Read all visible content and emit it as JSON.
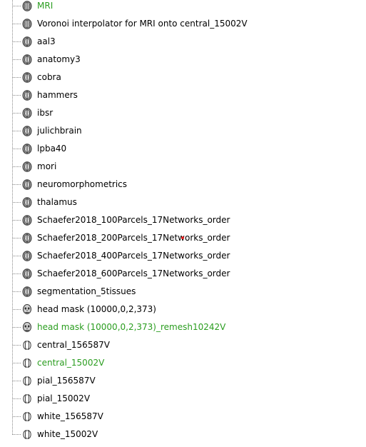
{
  "items": [
    {
      "label": "MRI",
      "icon": "volume-icon",
      "color": "#2a9d1f",
      "highlighted": true
    },
    {
      "label": "Voronoi interpolator for MRI onto central_15002V",
      "icon": "volume-icon",
      "highlighted": false
    },
    {
      "label": "aal3",
      "icon": "atlas-icon",
      "highlighted": false
    },
    {
      "label": "anatomy3",
      "icon": "atlas-icon",
      "highlighted": false
    },
    {
      "label": "cobra",
      "icon": "atlas-icon",
      "highlighted": false
    },
    {
      "label": "hammers",
      "icon": "atlas-icon",
      "highlighted": false
    },
    {
      "label": "ibsr",
      "icon": "atlas-icon",
      "highlighted": false
    },
    {
      "label": "julichbrain",
      "icon": "atlas-icon",
      "highlighted": false
    },
    {
      "label": "lpba40",
      "icon": "atlas-icon",
      "highlighted": false
    },
    {
      "label": "mori",
      "icon": "atlas-icon",
      "highlighted": false
    },
    {
      "label": "neuromorphometrics",
      "icon": "atlas-icon",
      "highlighted": false
    },
    {
      "label": "thalamus",
      "icon": "atlas-icon",
      "highlighted": false
    },
    {
      "label": "Schaefer2018_100Parcels_17Networks_order",
      "icon": "atlas-icon",
      "highlighted": false
    },
    {
      "label": "Schaefer2018_200Parcels_17Networks_order",
      "icon": "atlas-icon",
      "highlighted": false
    },
    {
      "label": "Schaefer2018_400Parcels_17Networks_order",
      "icon": "atlas-icon",
      "highlighted": false
    },
    {
      "label": "Schaefer2018_600Parcels_17Networks_order",
      "icon": "atlas-icon",
      "highlighted": false
    },
    {
      "label": "segmentation_5tissues",
      "icon": "atlas-icon",
      "highlighted": false
    },
    {
      "label": "head mask (10000,0,2,373)",
      "icon": "head-icon",
      "highlighted": false
    },
    {
      "label": "head mask (10000,0,2,373)_remesh10242V",
      "icon": "head-icon",
      "color": "#2a9d1f",
      "highlighted": true
    },
    {
      "label": "central_156587V",
      "icon": "cortex-surface-icon",
      "highlighted": false
    },
    {
      "label": "central_15002V",
      "icon": "cortex-surface-icon",
      "color": "#2a9d1f",
      "highlighted": true
    },
    {
      "label": "pial_156587V",
      "icon": "cortex-surface-icon",
      "highlighted": false
    },
    {
      "label": "pial_15002V",
      "icon": "cortex-surface-icon",
      "highlighted": false
    },
    {
      "label": "white_156587V",
      "icon": "cortex-surface-icon",
      "highlighted": false
    },
    {
      "label": "white_15002V",
      "icon": "cortex-surface-icon",
      "highlighted": false
    }
  ],
  "colors": {
    "highlight": "#2a9d1f",
    "text": "#000000",
    "tree_line": "#888888",
    "cursor_dot": "#e02020"
  }
}
